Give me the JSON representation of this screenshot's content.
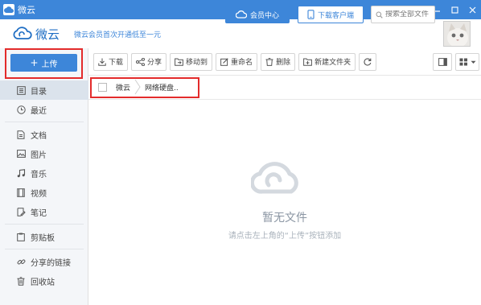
{
  "window": {
    "title": "微云"
  },
  "header": {
    "brand": "微云",
    "promo": "微云会员首次开通低至一元",
    "vip_label": "会员中心",
    "download_label": "下载客户端",
    "search_placeholder": "搜索全部文件"
  },
  "sidebar": {
    "upload_label": "上传",
    "items": [
      {
        "label": "目录",
        "icon": "list-icon"
      },
      {
        "label": "最近",
        "icon": "clock-icon"
      },
      {
        "label": "文档",
        "icon": "document-icon"
      },
      {
        "label": "图片",
        "icon": "image-icon"
      },
      {
        "label": "音乐",
        "icon": "music-icon"
      },
      {
        "label": "视频",
        "icon": "video-icon"
      },
      {
        "label": "笔记",
        "icon": "note-icon"
      },
      {
        "label": "剪贴板",
        "icon": "clipboard-icon"
      },
      {
        "label": "分享的链接",
        "icon": "link-icon"
      },
      {
        "label": "回收站",
        "icon": "trash-icon"
      }
    ]
  },
  "toolbar": {
    "download": "下载",
    "share": "分享",
    "move": "移动到",
    "rename": "重命名",
    "delete": "删除",
    "new_folder": "新建文件夹"
  },
  "breadcrumb": {
    "root": "微云",
    "current": "网络硬盘.."
  },
  "empty": {
    "title": "暂无文件",
    "hint": "请点击左上角的“上传”按钮添加"
  },
  "colors": {
    "accent": "#3d86d9",
    "highlight": "#e32b2b"
  }
}
